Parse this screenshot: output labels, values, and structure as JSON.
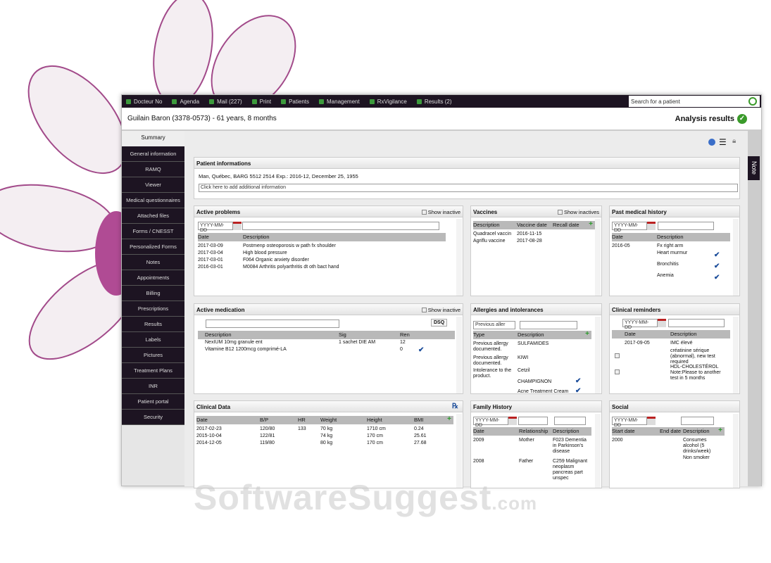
{
  "nav": {
    "items": [
      "Docteur No",
      "Agenda",
      "Mail (227)",
      "Print",
      "Patients",
      "Management",
      "RxVigilance",
      "Results (2)"
    ],
    "search_placeholder": "Search for a patient"
  },
  "header": {
    "patient": "Guilain Baron (3378-0573) - 61 years, 8 months",
    "analysis": "Analysis results"
  },
  "sidebar": {
    "summary": "Summary",
    "items": [
      "General information",
      "RAMQ",
      "Viewer",
      "Medical questionnaires",
      "Attached files",
      "Forms / CNESST",
      "Personalized Forms",
      "Notes",
      "Appointments",
      "Billing",
      "Prescriptions",
      "Results",
      "Labels",
      "Pictures",
      "Treatment Plans",
      "INR",
      "Patient portal",
      "Security"
    ]
  },
  "note_tab": "Note",
  "patient_info": {
    "title": "Patient informations",
    "line": "Man, Québec, BARG 5512 2514 Exp.: 2016-12, December 25, 1955",
    "add": "Click here to add additional information"
  },
  "date_placeholder": "YYYY-MM-DD",
  "active_problems": {
    "title": "Active problems",
    "show_inactive": "Show inactive",
    "headers": [
      "Date",
      "Description"
    ],
    "rows": [
      [
        "2017-03-09",
        "Postmenp osteoporosis w path fx shoulder"
      ],
      [
        "2017-03-04",
        "High blood pressure"
      ],
      [
        "2017-03-01",
        "F064 Organic anxiety disorder"
      ],
      [
        "2016-03-01",
        "M0084 Arthritis polyarthritis dt oth bact hand"
      ]
    ]
  },
  "vaccines": {
    "title": "Vaccines",
    "show_inactive": "Show inactives",
    "headers": [
      "Description",
      "Vaccine date",
      "Recall date"
    ],
    "rows": [
      [
        "Quadracel vaccin",
        "2016-11-15"
      ],
      [
        "Agriflu vaccine",
        "2017-08-28"
      ]
    ]
  },
  "past_history": {
    "title": "Past medical history",
    "headers": [
      "Date",
      "Description"
    ],
    "rows": [
      [
        "2016-05",
        "Fx right arm"
      ],
      [
        "",
        "Heart murmur"
      ],
      [
        "",
        "Bronchitis"
      ],
      [
        "",
        "Anemia"
      ]
    ]
  },
  "active_medication": {
    "title": "Active medication",
    "show_inactive": "Show inactive",
    "dsq": "DSQ",
    "headers": [
      "Description",
      "Sig",
      "Ren"
    ],
    "rows": [
      [
        "NexIUM 10mg granule ent",
        "1 sachet DIE AM",
        "12"
      ],
      [
        "Vitamine B12 1200mcg comprimé-LA",
        "",
        "0"
      ]
    ]
  },
  "allergies": {
    "title": "Allergies and intolerances",
    "select": "Previous aller",
    "headers": [
      "Type",
      "Description"
    ],
    "rows": [
      [
        "Previous allergy documented.",
        "SULFAMIDES"
      ],
      [
        "Previous allergy documented.",
        "KIWI"
      ],
      [
        "Intolerance to the product.",
        "Cetzil"
      ],
      [
        "",
        "CHAMPIGNON"
      ],
      [
        "",
        "Acne Treatment Cream"
      ]
    ]
  },
  "reminders": {
    "title": "Clinical reminders",
    "headers": [
      "Date",
      "Description"
    ],
    "rows": [
      [
        "2017-09-05",
        "IMC élevé"
      ],
      [
        "",
        "créatinine sérique (abnormal), new test required"
      ],
      [
        "",
        "HDL-CHOLESTÉROL Note:Please to another test in 5 months"
      ]
    ]
  },
  "clinical_data": {
    "title": "Clinical Data",
    "headers": [
      "Date",
      "B/P",
      "HR",
      "Weight",
      "Height",
      "BMI"
    ],
    "rows": [
      [
        "2017-02-23",
        "120/80",
        "133",
        "70 kg",
        "1710 cm",
        "0.24"
      ],
      [
        "2015-10-04",
        "122/81",
        "",
        "74 kg",
        "170 cm",
        "25.61"
      ],
      [
        "2014-12-05",
        "119/80",
        "",
        "80 kg",
        "170 cm",
        "27.68"
      ]
    ]
  },
  "family": {
    "title": "Family History",
    "headers": [
      "Date",
      "Relationship",
      "Description"
    ],
    "rows": [
      [
        "2009",
        "Mother",
        "F023 Dementia in Parkinson's disease"
      ],
      [
        "2008",
        "Father",
        "C259 Malignant neoplasm pancreas part unspec"
      ]
    ]
  },
  "social": {
    "title": "Social",
    "headers": [
      "Start date",
      "End date",
      "Description"
    ],
    "rows": [
      [
        "2000",
        "",
        "Consumes alcohol (5 drinks/week)"
      ],
      [
        "",
        "",
        "Non smoker"
      ]
    ]
  },
  "watermark": "SoftwareSuggest",
  "watermark_suffix": ".com",
  "colors": {
    "nav_bg": "#1d1422",
    "accent_green": "#3a9a2a",
    "check_blue": "#1a4c9a"
  }
}
